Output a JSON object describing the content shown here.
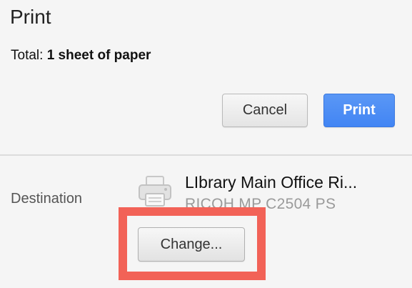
{
  "dialog": {
    "title": "Print",
    "total_label": "Total:",
    "total_value": "1 sheet of paper"
  },
  "buttons": {
    "cancel_label": "Cancel",
    "print_label": "Print"
  },
  "destination": {
    "label": "Destination",
    "printer_name": "LIbrary Main Office Ri...",
    "printer_model": "RICOH MP C2504 PS",
    "change_label": "Change...",
    "icon": "printer-icon"
  },
  "colors": {
    "print_button": "#4285f4",
    "highlight": "#f26257",
    "background": "#f5f5f5"
  }
}
